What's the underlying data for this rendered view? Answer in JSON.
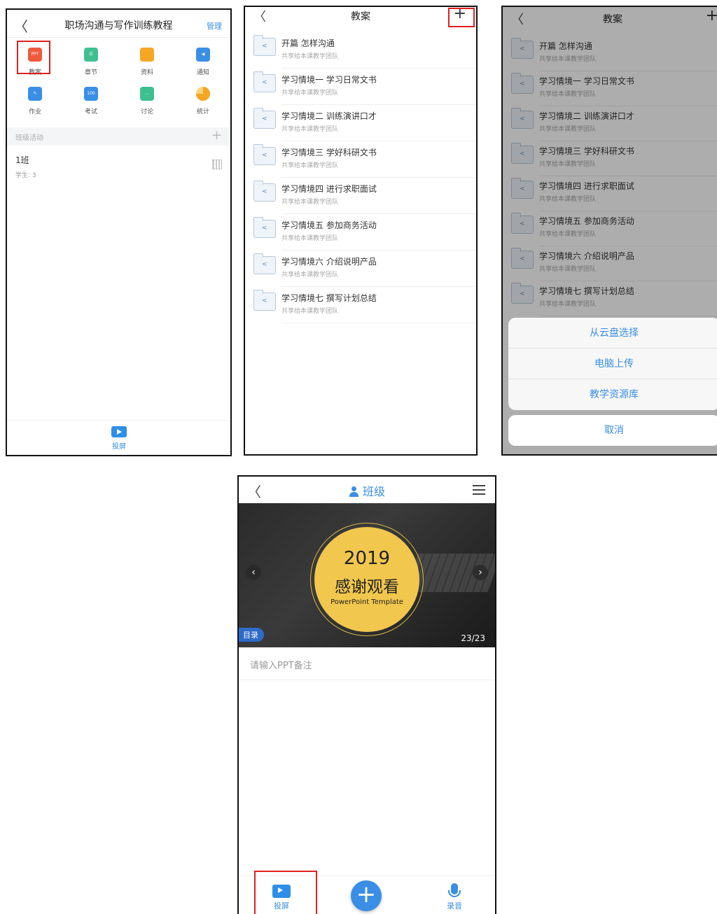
{
  "phone1": {
    "back_glyph": "〈",
    "title": "职场沟通与写作训练教程",
    "manage": "管理",
    "grid": [
      {
        "label": "教案",
        "icon": "ppt-icon",
        "color": "#f05a3c",
        "glyph": "PPT"
      },
      {
        "label": "章节",
        "icon": "chapter-list-icon",
        "color": "#3fbf8f",
        "glyph": "☰"
      },
      {
        "label": "资料",
        "icon": "folder-icon",
        "color": "#f5a623",
        "glyph": ""
      },
      {
        "label": "通知",
        "icon": "speaker-icon",
        "color": "#3a8ee6",
        "glyph": "◀"
      },
      {
        "label": "作业",
        "icon": "homework-icon",
        "color": "#3a8ee6",
        "glyph": "✎"
      },
      {
        "label": "考试",
        "icon": "exam-icon",
        "color": "#3a8ee6",
        "glyph": "100"
      },
      {
        "label": "讨论",
        "icon": "discussion-icon",
        "color": "#3fbf8f",
        "glyph": "…"
      },
      {
        "label": "统计",
        "icon": "pie-chart-icon",
        "color": "#f5a623",
        "glyph": ""
      }
    ],
    "section": "班级活动",
    "section_add": "+",
    "class_name": "1班",
    "class_students": "学生: 3",
    "footer": "投屏"
  },
  "phone2": {
    "back_glyph": "〈",
    "title": "教案",
    "plus": "+",
    "items": [
      {
        "name": "开篇 怎样沟通",
        "sub": "共享给本课教学团队"
      },
      {
        "name": "学习情境一 学习日常文书",
        "sub": "共享给本课教学团队"
      },
      {
        "name": "学习情境二 训练演讲口才",
        "sub": "共享给本课教学团队"
      },
      {
        "name": "学习情境三 学好科研文书",
        "sub": "共享给本课教学团队"
      },
      {
        "name": "学习情境四 进行求职面试",
        "sub": "共享给本课教学团队"
      },
      {
        "name": "学习情境五 参加商务活动",
        "sub": "共享给本课教学团队"
      },
      {
        "name": "学习情境六 介绍说明产品",
        "sub": "共享给本课教学团队"
      },
      {
        "name": "学习情境七 撰写计划总结",
        "sub": "共享给本课教学团队"
      }
    ]
  },
  "phone3": {
    "back_glyph": "〈",
    "title": "教案",
    "plus": "+",
    "items": [
      {
        "name": "开篇 怎样沟通",
        "sub": "共享给本课教学团队"
      },
      {
        "name": "学习情境一 学习日常文书",
        "sub": "共享给本课教学团队"
      },
      {
        "name": "学习情境二 训练演讲口才",
        "sub": "共享给本课教学团队"
      },
      {
        "name": "学习情境三 学好科研文书",
        "sub": "共享给本课教学团队"
      },
      {
        "name": "学习情境四 进行求职面试",
        "sub": "共享给本课教学团队"
      },
      {
        "name": "学习情境五 参加商务活动",
        "sub": "共享给本课教学团队"
      },
      {
        "name": "学习情境六 介绍说明产品",
        "sub": "共享给本课教学团队"
      },
      {
        "name": "学习情境七 撰写计划总结",
        "sub": "共享给本课教学团队"
      }
    ],
    "sheet": [
      "从云盘选择",
      "电脑上传",
      "教学资源库"
    ],
    "cancel": "取消"
  },
  "phone4": {
    "back_glyph": "〈",
    "title": "班级",
    "slide_year": "2019",
    "slide_thanks": "感谢观看",
    "slide_template": "PowerPoint Template",
    "toc": "目录",
    "page": "23/23",
    "note_placeholder": "请输入PPT备注",
    "footer_cast": "投屏",
    "footer_add": "+",
    "footer_record": "录音"
  },
  "colors": {
    "accent": "#3a8ee6",
    "highlight": "#e02020",
    "slide_circle": "#f1c74d"
  }
}
